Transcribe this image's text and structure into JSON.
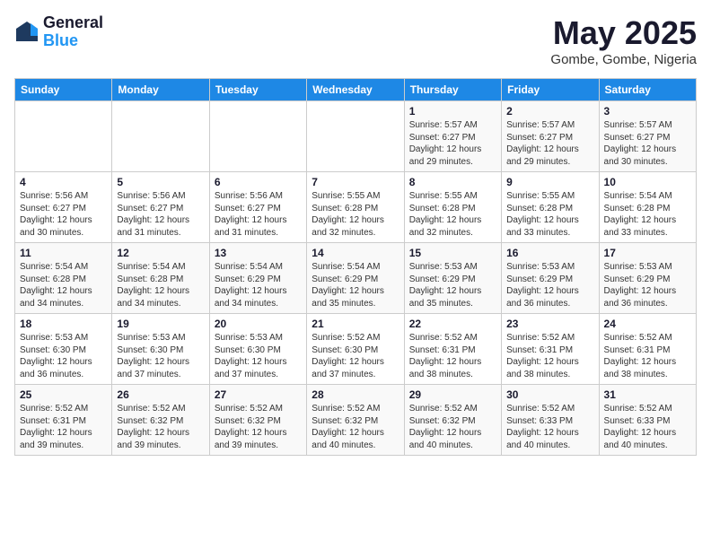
{
  "header": {
    "logo_line1": "General",
    "logo_line2": "Blue",
    "title": "May 2025",
    "subtitle": "Gombe, Gombe, Nigeria"
  },
  "days_of_week": [
    "Sunday",
    "Monday",
    "Tuesday",
    "Wednesday",
    "Thursday",
    "Friday",
    "Saturday"
  ],
  "weeks": [
    [
      {
        "day": "",
        "info": ""
      },
      {
        "day": "",
        "info": ""
      },
      {
        "day": "",
        "info": ""
      },
      {
        "day": "",
        "info": ""
      },
      {
        "day": "1",
        "info": "Sunrise: 5:57 AM\nSunset: 6:27 PM\nDaylight: 12 hours\nand 29 minutes."
      },
      {
        "day": "2",
        "info": "Sunrise: 5:57 AM\nSunset: 6:27 PM\nDaylight: 12 hours\nand 29 minutes."
      },
      {
        "day": "3",
        "info": "Sunrise: 5:57 AM\nSunset: 6:27 PM\nDaylight: 12 hours\nand 30 minutes."
      }
    ],
    [
      {
        "day": "4",
        "info": "Sunrise: 5:56 AM\nSunset: 6:27 PM\nDaylight: 12 hours\nand 30 minutes."
      },
      {
        "day": "5",
        "info": "Sunrise: 5:56 AM\nSunset: 6:27 PM\nDaylight: 12 hours\nand 31 minutes."
      },
      {
        "day": "6",
        "info": "Sunrise: 5:56 AM\nSunset: 6:27 PM\nDaylight: 12 hours\nand 31 minutes."
      },
      {
        "day": "7",
        "info": "Sunrise: 5:55 AM\nSunset: 6:28 PM\nDaylight: 12 hours\nand 32 minutes."
      },
      {
        "day": "8",
        "info": "Sunrise: 5:55 AM\nSunset: 6:28 PM\nDaylight: 12 hours\nand 32 minutes."
      },
      {
        "day": "9",
        "info": "Sunrise: 5:55 AM\nSunset: 6:28 PM\nDaylight: 12 hours\nand 33 minutes."
      },
      {
        "day": "10",
        "info": "Sunrise: 5:54 AM\nSunset: 6:28 PM\nDaylight: 12 hours\nand 33 minutes."
      }
    ],
    [
      {
        "day": "11",
        "info": "Sunrise: 5:54 AM\nSunset: 6:28 PM\nDaylight: 12 hours\nand 34 minutes."
      },
      {
        "day": "12",
        "info": "Sunrise: 5:54 AM\nSunset: 6:28 PM\nDaylight: 12 hours\nand 34 minutes."
      },
      {
        "day": "13",
        "info": "Sunrise: 5:54 AM\nSunset: 6:29 PM\nDaylight: 12 hours\nand 34 minutes."
      },
      {
        "day": "14",
        "info": "Sunrise: 5:54 AM\nSunset: 6:29 PM\nDaylight: 12 hours\nand 35 minutes."
      },
      {
        "day": "15",
        "info": "Sunrise: 5:53 AM\nSunset: 6:29 PM\nDaylight: 12 hours\nand 35 minutes."
      },
      {
        "day": "16",
        "info": "Sunrise: 5:53 AM\nSunset: 6:29 PM\nDaylight: 12 hours\nand 36 minutes."
      },
      {
        "day": "17",
        "info": "Sunrise: 5:53 AM\nSunset: 6:29 PM\nDaylight: 12 hours\nand 36 minutes."
      }
    ],
    [
      {
        "day": "18",
        "info": "Sunrise: 5:53 AM\nSunset: 6:30 PM\nDaylight: 12 hours\nand 36 minutes."
      },
      {
        "day": "19",
        "info": "Sunrise: 5:53 AM\nSunset: 6:30 PM\nDaylight: 12 hours\nand 37 minutes."
      },
      {
        "day": "20",
        "info": "Sunrise: 5:53 AM\nSunset: 6:30 PM\nDaylight: 12 hours\nand 37 minutes."
      },
      {
        "day": "21",
        "info": "Sunrise: 5:52 AM\nSunset: 6:30 PM\nDaylight: 12 hours\nand 37 minutes."
      },
      {
        "day": "22",
        "info": "Sunrise: 5:52 AM\nSunset: 6:31 PM\nDaylight: 12 hours\nand 38 minutes."
      },
      {
        "day": "23",
        "info": "Sunrise: 5:52 AM\nSunset: 6:31 PM\nDaylight: 12 hours\nand 38 minutes."
      },
      {
        "day": "24",
        "info": "Sunrise: 5:52 AM\nSunset: 6:31 PM\nDaylight: 12 hours\nand 38 minutes."
      }
    ],
    [
      {
        "day": "25",
        "info": "Sunrise: 5:52 AM\nSunset: 6:31 PM\nDaylight: 12 hours\nand 39 minutes."
      },
      {
        "day": "26",
        "info": "Sunrise: 5:52 AM\nSunset: 6:32 PM\nDaylight: 12 hours\nand 39 minutes."
      },
      {
        "day": "27",
        "info": "Sunrise: 5:52 AM\nSunset: 6:32 PM\nDaylight: 12 hours\nand 39 minutes."
      },
      {
        "day": "28",
        "info": "Sunrise: 5:52 AM\nSunset: 6:32 PM\nDaylight: 12 hours\nand 40 minutes."
      },
      {
        "day": "29",
        "info": "Sunrise: 5:52 AM\nSunset: 6:32 PM\nDaylight: 12 hours\nand 40 minutes."
      },
      {
        "day": "30",
        "info": "Sunrise: 5:52 AM\nSunset: 6:33 PM\nDaylight: 12 hours\nand 40 minutes."
      },
      {
        "day": "31",
        "info": "Sunrise: 5:52 AM\nSunset: 6:33 PM\nDaylight: 12 hours\nand 40 minutes."
      }
    ]
  ]
}
